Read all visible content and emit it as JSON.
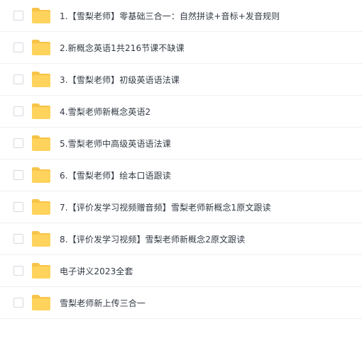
{
  "colors": {
    "folder_body": "#FFD35C",
    "folder_tab": "#F7C448",
    "text": "#333a44",
    "divider": "#eef0f2"
  },
  "items": [
    {
      "name": "1.【雪梨老师】零基础三合一：自然拼读+音标+发音规则",
      "icon": "folder-icon"
    },
    {
      "name": "2.新概念英语1共216节课不缺课",
      "icon": "folder-icon"
    },
    {
      "name": "3.【雪梨老师】初级英语语法课",
      "icon": "folder-icon"
    },
    {
      "name": "4.雪梨老师新概念英语2",
      "icon": "folder-icon"
    },
    {
      "name": "5.雪梨老师中高级英语语法课",
      "icon": "folder-icon"
    },
    {
      "name": "6.【雪梨老师】绘本口语跟读",
      "icon": "folder-icon"
    },
    {
      "name": "7.【评价发学习视频赠音频】雪梨老师新概念1原文跟读",
      "icon": "folder-icon"
    },
    {
      "name": "8.【评价发学习视频】雪梨老师新概念2原文跟读",
      "icon": "folder-icon"
    },
    {
      "name": "电子讲义2023全套",
      "icon": "folder-icon"
    },
    {
      "name": "雪梨老师新上传三合一",
      "icon": "folder-icon"
    }
  ]
}
